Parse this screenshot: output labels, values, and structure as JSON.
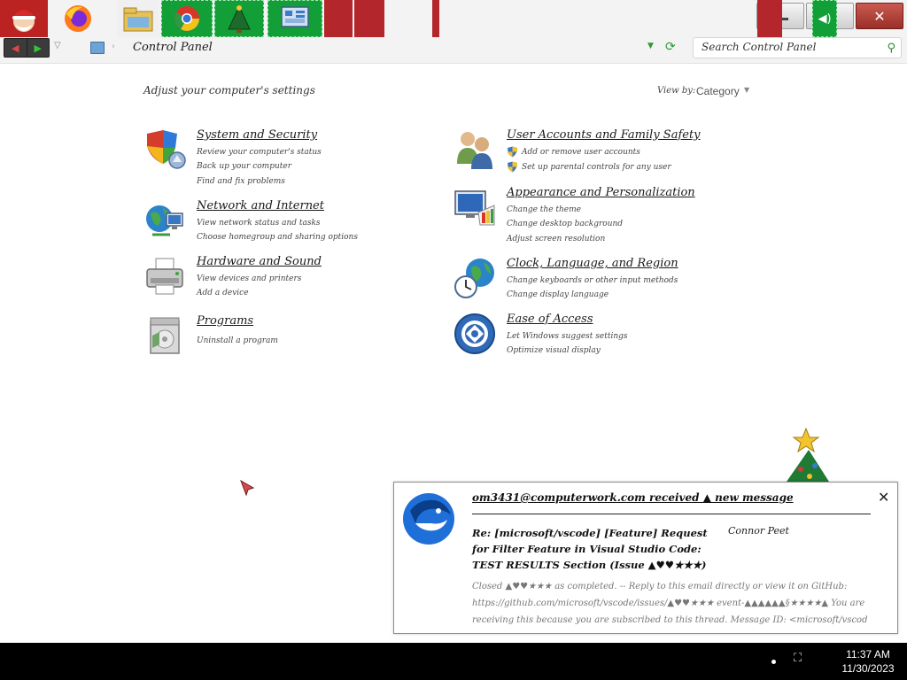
{
  "window": {
    "minimize_label": "—",
    "maximize_label": "❐",
    "close_label": "✕"
  },
  "address": {
    "back_icon": "◀",
    "forward_icon": "▶",
    "history_icon": "▽",
    "separator": "›",
    "breadcrumb": "Control Panel",
    "dropdown_icon": "▼",
    "refresh_icon": "⟳",
    "search_placeholder": "Search Control Panel",
    "search_icon": "⚲"
  },
  "content": {
    "heading": "Adjust your computer's settings",
    "view_by_label": "View by:",
    "view_by_value": "Category",
    "view_by_arrow": "▼",
    "categories": [
      {
        "title": "System and Security",
        "icon": "shield-icon",
        "links": [
          "Review your computer's status",
          "Back up your computer",
          "Find and fix problems"
        ]
      },
      {
        "title": "Network and Internet",
        "icon": "globe-network-icon",
        "links": [
          "View network status and tasks",
          "Choose homegroup and sharing options"
        ]
      },
      {
        "title": "Hardware and Sound",
        "icon": "printer-icon",
        "links": [
          "View devices and printers",
          "Add a device"
        ]
      },
      {
        "title": "Programs",
        "icon": "programs-icon",
        "links": [
          "Uninstall a program"
        ]
      },
      {
        "title": "User Accounts and Family Safety",
        "icon": "users-icon",
        "links": [
          "Add or remove user accounts",
          "Set up parental controls for any user"
        ]
      },
      {
        "title": "Appearance and Personalization",
        "icon": "monitor-palette-icon",
        "links": [
          "Change the theme",
          "Change desktop background",
          "Adjust screen resolution"
        ]
      },
      {
        "title": "Clock, Language, and Region",
        "icon": "clock-globe-icon",
        "links": [
          "Change keyboards or other input methods",
          "Change display language"
        ]
      },
      {
        "title": "Ease of Access",
        "icon": "ease-of-access-icon",
        "links": [
          "Let Windows suggest settings",
          "Optimize visual display"
        ]
      }
    ]
  },
  "notification": {
    "title": "om3431@computerwork.com received ▲ new message",
    "subject": "Re: [microsoft/vscode] [Feature] Request for Filter Feature in Visual Studio Code: TEST RESULTS Section (Issue ▲♥♥★★★)",
    "sender": "Connor Peet",
    "body": "Closed ▲♥♥★★★ as completed. -- Reply to this email directly or view it on GitHub: https://github.com/microsoft/vscode/issues/▲♥♥★★★ event-▲▲▲▲▲▲§★★★★▲ You are receiving this because you are subscribed to this thread. Message ID: <microsoft/vscod",
    "close_label": "✕"
  },
  "taskbar": {
    "clock_time": "11:37 AM",
    "clock_date": "11/30/2023",
    "network_icon": "⛶",
    "volume_icon": "🔊"
  },
  "colors": {
    "taskbar_green": "#129f37",
    "taskbar_red": "#b3262c",
    "close_button": "#b5443b"
  }
}
